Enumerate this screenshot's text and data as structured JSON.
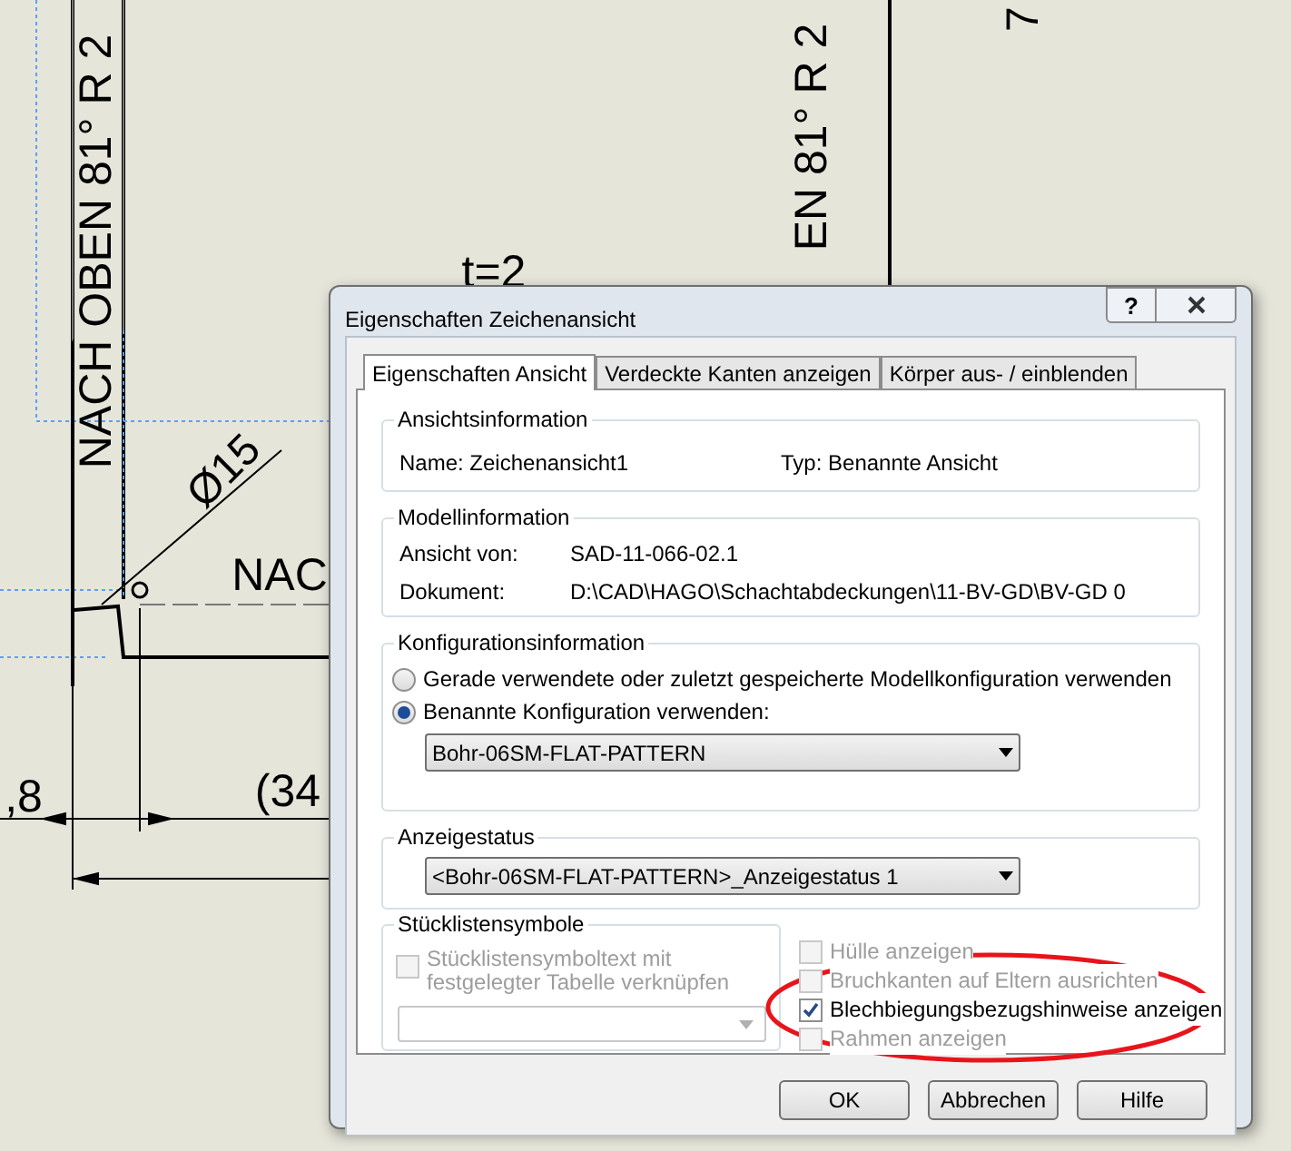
{
  "drawing": {
    "labels": [
      {
        "text": "NACH OBEN 81° R 2",
        "kind": "vertical"
      },
      {
        "text": "EN 81° R 2",
        "kind": "vertical"
      },
      {
        "text": "7",
        "kind": "vertical"
      },
      {
        "text": "t=2",
        "kind": "flat"
      },
      {
        "text": "Ø15",
        "kind": "diagonal"
      },
      {
        "text": "NAC",
        "kind": "flat"
      },
      {
        "text": ",8",
        "kind": "flat"
      },
      {
        "text": "(34",
        "kind": "flat"
      }
    ]
  },
  "dialog": {
    "title": "Eigenschaften Zeichenansicht",
    "help_button": "?",
    "tabs": [
      {
        "label": "Eigenschaften Ansicht",
        "selected": true
      },
      {
        "label": "Verdeckte Kanten anzeigen",
        "selected": false
      },
      {
        "label": "Körper aus- / einblenden",
        "selected": false
      }
    ],
    "view_info": {
      "title": "Ansichtsinformation",
      "name": "Name: Zeichenansicht1",
      "type": "Typ: Benannte Ansicht"
    },
    "model_info": {
      "title": "Modellinformation",
      "rows": [
        {
          "label": "Ansicht von:",
          "value": "SAD-11-066-02.1"
        },
        {
          "label": "Dokument:",
          "value": "D:\\CAD\\HAGO\\Schachtabdeckungen\\11-BV-GD\\BV-GD 0"
        }
      ]
    },
    "config_info": {
      "title": "Konfigurationsinformation",
      "options": [
        {
          "label": "Gerade verwendete oder zuletzt gespeicherte Modellkonfiguration verwenden",
          "selected": false
        },
        {
          "label": "Benannte Konfiguration verwenden:",
          "selected": true
        }
      ],
      "dropdown": "Bohr-06SM-FLAT-PATTERN"
    },
    "display_state": {
      "title": "Anzeigestatus",
      "dropdown": "<Bohr-06SM-FLAT-PATTERN>_Anzeigestatus 1"
    },
    "bom": {
      "title": "Stücklistensymbole",
      "checkbox": {
        "label": "Stücklistensymboltext mit festgelegter Tabelle verknüpfen",
        "checked": false,
        "disabled": true
      }
    },
    "options": [
      {
        "label": "Hülle anzeigen",
        "checked": false,
        "disabled": true
      },
      {
        "label": "Bruchkanten auf Eltern ausrichten",
        "checked": false,
        "disabled": true
      },
      {
        "label": "Blechbiegungsbezugshinweise anzeigen",
        "checked": true,
        "disabled": false
      },
      {
        "label": "Rahmen anzeigen",
        "checked": false,
        "disabled": true
      }
    ],
    "buttons": [
      "OK",
      "Abbrechen",
      "Hilfe"
    ]
  }
}
